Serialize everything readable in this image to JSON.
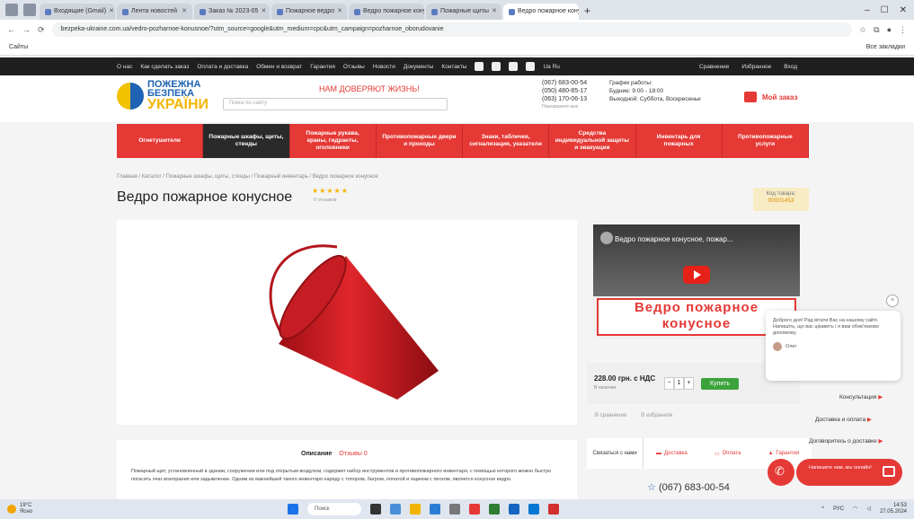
{
  "browser": {
    "tabs": [
      {
        "label": "Входящие (Gmail)"
      },
      {
        "label": "Лента новостей"
      },
      {
        "label": "Заказ № 2023-05"
      },
      {
        "label": "Пожарное ведро"
      },
      {
        "label": "Ведро пожарное конусное"
      },
      {
        "label": "Пожарные щиты"
      },
      {
        "label": "Ведро пожарное конусное",
        "active": true
      }
    ],
    "new_tab": "+",
    "window_controls": [
      "–",
      "☐",
      "✕"
    ],
    "url": "bezpeka-ukraine.com.ua/vedro-pozharnoe-konusnoe/?utm_source=google&utm_medium=cpc&utm_campaign=pozharnoe_oborudovanie",
    "bookmarks_left": "Сайты",
    "bookmarks_right": "Все закладки"
  },
  "topnav": {
    "links": [
      "О нас",
      "Как сделать заказ",
      "Оплата и доставка",
      "Обмен и возврат",
      "Гарантия",
      "Отзывы",
      "Новости",
      "Документы",
      "Контакты"
    ],
    "lang": "Ua  Ru",
    "right": [
      "Сравнение",
      "Избранное",
      "Вход"
    ]
  },
  "header": {
    "logo_line1": "ПОЖЕЖНА",
    "logo_line2": "БЕЗПЕКА",
    "logo_line3": "УКРАЇНИ",
    "slogan": "НАМ ДОВЕРЯЮТ ЖИЗНЬ!",
    "search_placeholder": "Поиск по сайту",
    "phones": [
      "(067) 683-00-54",
      "(050) 480-85-17",
      "(063) 170-06-13"
    ],
    "callback": "Перезвоните мне",
    "hours_title": "График работы:",
    "hours_weekdays": "Будние: 9:00 - 18:00",
    "hours_weekend": "Выходной: Суббота, Воскресенье",
    "cart_label": "Мой заказ"
  },
  "categories": [
    {
      "label": "Огнетушители",
      "active": false
    },
    {
      "label": "Пожарные шкафы, щиты, стенды",
      "active": true
    },
    {
      "label": "Пожарные рукава, краны, гидранты, оголовники",
      "active": false
    },
    {
      "label": "Противопожарные двери и проходы",
      "active": false
    },
    {
      "label": "Знаки, таблички, сигнализация, указатели",
      "active": false
    },
    {
      "label": "Средства индивидуальной защиты и эвакуации",
      "active": false
    },
    {
      "label": "Инвентарь для пожарных",
      "active": false
    },
    {
      "label": "Противопожарные услуги",
      "active": false
    }
  ],
  "breadcrumb": "Главная  /  Каталог  /  Пожарные шкафы, щиты, стенды  /  Пожарный инвентарь  /  Ведро пожарное конусное",
  "product": {
    "title": "Ведро пожарное конусное",
    "stars": "★★★★★",
    "reviews": "0 отзывов",
    "code_label": "Код товара:",
    "code": "00001453",
    "video_title": "Ведро пожарное конусное, пожар...",
    "video_caption_1": "Ведро пожарное",
    "video_caption_2": "конусное",
    "price": "228.00 грн. с НДС",
    "availability": "В наличии",
    "qty": "1",
    "buy_label": "Купить",
    "compare": "В сравнение",
    "wishlist": "В избранное"
  },
  "tabs": {
    "description": "Описание",
    "reviews": "Отзывы 0",
    "text": "Пожарный щит, установленный в здании, сооружении или под открытым воздухом, содержит набор инструментов и противопожарного инвентаря, с помощью которого можно быстро погасить очаг возгорания или задымление. Одним из важнейшей такого инвентаря наряду с топором, багром, лопатой и ящиком с песком, является конусное ведро."
  },
  "side_tabs": [
    "Связаться с нами",
    "Доставка",
    "Оплата",
    "Гарантия"
  ],
  "bottom_phone": "(067) 683-00-54",
  "chat": {
    "popup_text": "Доброго дня! Рад вітати Вас на нашому сайті. Напишіть, що вас цікавить і я вам обов'язково допоможу.",
    "agent": "Олег",
    "links": [
      "Консультация",
      "Доставка и оплата",
      "Договоритесь о доставке"
    ],
    "button_text": "Напишите нам, мы онлайн!",
    "close": "×"
  },
  "taskbar": {
    "temp": "19°C",
    "weather": "Ясно",
    "search": "Поиск",
    "time": "14:53",
    "date": "27.05.2024",
    "lang": "РУС"
  }
}
